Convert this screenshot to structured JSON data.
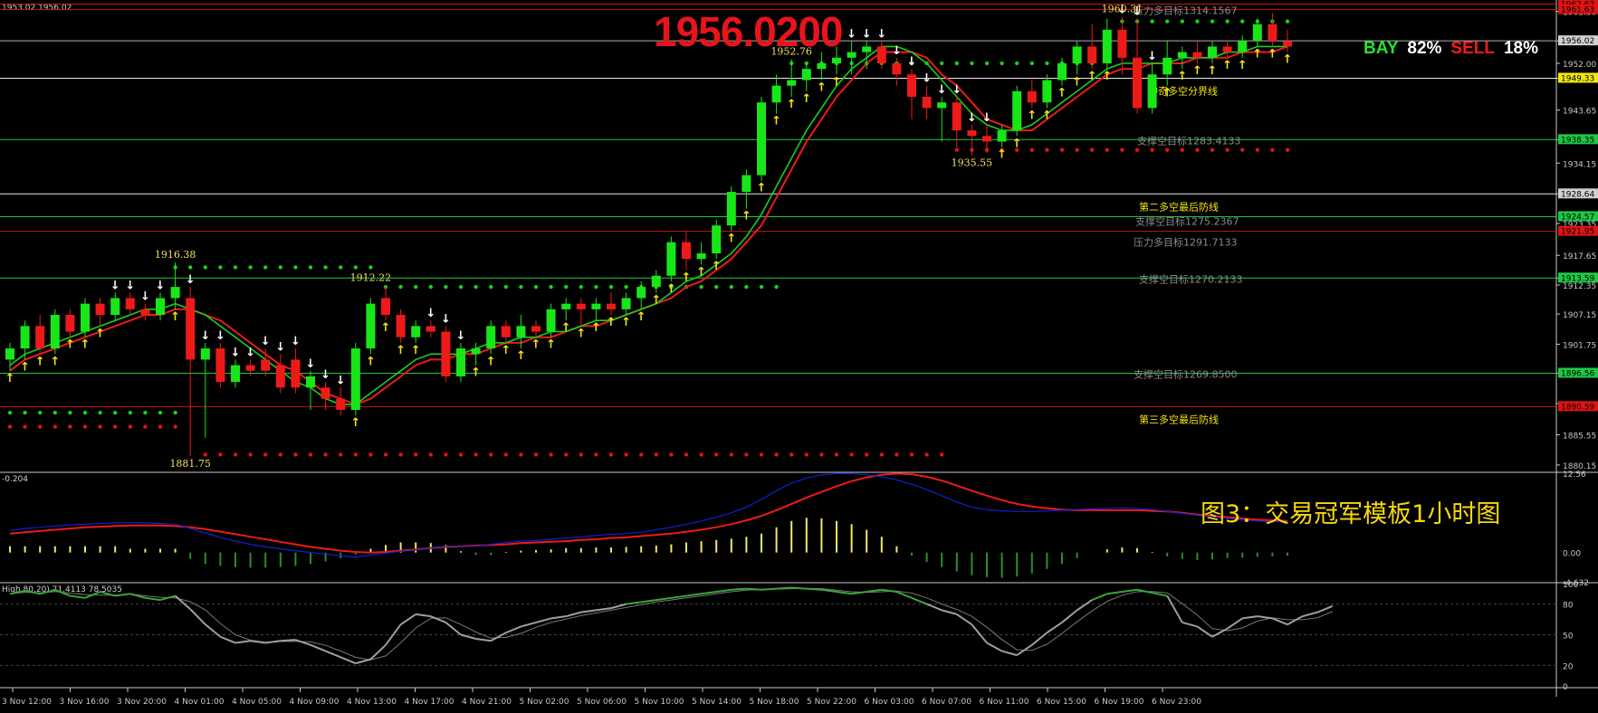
{
  "header": {
    "symbol_info": "1953.02 1956.02"
  },
  "big_price": "1956.0200",
  "sentiment": {
    "buy_label": "BAY",
    "buy_pct": "82%",
    "sell_label": "SELL",
    "sell_pct": "18%",
    "buy_color": "#27e12f",
    "sell_color": "#f51b1b"
  },
  "caption": "图3：交易冠军模板1小时图",
  "colors": {
    "bull": "#19e619",
    "bear": "#ee1a1a",
    "ma_fast": "#19d019",
    "ma_slow": "#ee1a1a",
    "macd_line": "#1020d0",
    "signal_line": "#ee1a1a",
    "stoch": "#9aa0a4",
    "stoch_hi": "#3aa63a"
  },
  "chart_data": {
    "type": "candlestick",
    "price_axis": {
      "range": [
        1879.0,
        1963.0
      ],
      "ticks": [
        "1961.30",
        "1956.02",
        "1952.00",
        "1949.33",
        "1943.65",
        "1938.35",
        "1934.15",
        "1928.64",
        "1923.35",
        "1917.65",
        "1913.59",
        "1912.35",
        "1907.15",
        "1901.75",
        "1896.56",
        "1891.15",
        "1885.55",
        "1880.15"
      ]
    },
    "price_tags": [
      {
        "value": 1962.6,
        "label": "1962.63",
        "color": "#e01414"
      },
      {
        "value": 1961.6,
        "label": "1961.63",
        "color": "#e01414"
      },
      {
        "value": 1956.02,
        "label": "1956.02",
        "color": "#d0d0d0"
      },
      {
        "value": 1949.33,
        "label": "1949.33",
        "color": "#f2e60c"
      },
      {
        "value": 1938.35,
        "label": "1938.35",
        "color": "#1ec845"
      },
      {
        "value": 1928.64,
        "label": "1928.64",
        "color": "#d0d0d0"
      },
      {
        "value": 1924.57,
        "label": "1924.57",
        "color": "#1ec845"
      },
      {
        "value": 1921.95,
        "label": "1921.95",
        "color": "#e01414"
      },
      {
        "value": 1913.59,
        "label": "1913.59",
        "color": "#1ec845"
      },
      {
        "value": 1896.56,
        "label": "1896.56",
        "color": "#1ec845"
      },
      {
        "value": 1890.59,
        "label": "1890.59",
        "color": "#e01414"
      }
    ],
    "levels": [
      {
        "value": 1962.6,
        "color": "#c81414",
        "text": ""
      },
      {
        "value": 1961.6,
        "color": "#c81414",
        "text": "压力多目标1314.1567"
      },
      {
        "value": 1956.02,
        "color": "#b0b0b0",
        "text": ""
      },
      {
        "value": 1949.33,
        "color": "#e8e8e8",
        "text": "神奇多空分界线"
      },
      {
        "value": 1938.35,
        "color": "#1ec845",
        "text": "支撑空目标1283.4133"
      },
      {
        "value": 1928.64,
        "color": "#e8e8e8",
        "text": "第二多空最后防线"
      },
      {
        "value": 1924.57,
        "color": "#1ec845",
        "text": "支撑空目标1275.2367"
      },
      {
        "value": 1921.95,
        "color": "#c81414",
        "text": "压力多目标1291.7133"
      },
      {
        "value": 1913.59,
        "color": "#1ec845",
        "text": "支撑空目标1270.2133"
      },
      {
        "value": 1896.56,
        "color": "#1ec845",
        "text": "支撑空目标1269.8500"
      },
      {
        "value": 1890.59,
        "color": "#c81414",
        "text": "第三多空最后防线"
      }
    ],
    "x_labels": [
      "3 Nov 12:00",
      "3 Nov 16:00",
      "3 Nov 20:00",
      "4 Nov 01:00",
      "4 Nov 05:00",
      "4 Nov 09:00",
      "4 Nov 13:00",
      "4 Nov 17:00",
      "4 Nov 21:00",
      "5 Nov 02:00",
      "5 Nov 06:00",
      "5 Nov 10:00",
      "5 Nov 14:00",
      "5 Nov 18:00",
      "5 Nov 22:00",
      "6 Nov 03:00",
      "6 Nov 07:00",
      "6 Nov 11:00",
      "6 Nov 15:00",
      "6 Nov 19:00",
      "6 Nov 23:00"
    ],
    "annotations": [
      {
        "label": "1916.38",
        "value": 1916.38,
        "bar": 11
      },
      {
        "label": "1881.75",
        "value": 1881.75,
        "bar": 12
      },
      {
        "label": "1912.22",
        "value": 1912.22,
        "bar": 24
      },
      {
        "label": "1952.76",
        "value": 1952.76,
        "bar": 52
      },
      {
        "label": "1935.55",
        "value": 1935.55,
        "bar": 64
      },
      {
        "label": "1960.31",
        "value": 1960.31,
        "bar": 74
      }
    ],
    "candles": [
      [
        1899,
        1902,
        1897,
        1901
      ],
      [
        1901,
        1906,
        1899,
        1905
      ],
      [
        1905,
        1907,
        1900,
        1901
      ],
      [
        1901,
        1908,
        1900,
        1907
      ],
      [
        1907,
        1908,
        1903,
        1904
      ],
      [
        1904,
        1910,
        1903,
        1909
      ],
      [
        1909,
        1910,
        1905,
        1907
      ],
      [
        1907,
        1911,
        1906,
        1910
      ],
      [
        1910,
        1911,
        1907,
        1908
      ],
      [
        1908,
        1909,
        1906,
        1907
      ],
      [
        1907,
        1911,
        1906,
        1910
      ],
      [
        1910,
        1916.38,
        1908,
        1912
      ],
      [
        1910,
        1912,
        1881.75,
        1899
      ],
      [
        1899,
        1902,
        1885,
        1901
      ],
      [
        1901,
        1902,
        1894,
        1895
      ],
      [
        1895,
        1899,
        1894,
        1898
      ],
      [
        1898,
        1899,
        1896,
        1897
      ],
      [
        1899,
        1901,
        1896,
        1897
      ],
      [
        1898,
        1900,
        1893,
        1894
      ],
      [
        1899,
        1901,
        1893,
        1894
      ],
      [
        1894,
        1897,
        1890,
        1896
      ],
      [
        1894,
        1895,
        1890,
        1892
      ],
      [
        1892,
        1894,
        1889,
        1890
      ],
      [
        1890,
        1902,
        1889,
        1901
      ],
      [
        1901,
        1910,
        1900,
        1909
      ],
      [
        1910,
        1912.22,
        1906,
        1907
      ],
      [
        1907,
        1908,
        1902,
        1903
      ],
      [
        1903,
        1906,
        1902,
        1905
      ],
      [
        1905,
        1906,
        1903,
        1904
      ],
      [
        1904,
        1905,
        1895,
        1896
      ],
      [
        1896,
        1902,
        1895,
        1901
      ],
      [
        1900,
        1902,
        1898,
        1901
      ],
      [
        1901,
        1906,
        1900,
        1905
      ],
      [
        1905,
        1906,
        1902,
        1903
      ],
      [
        1903,
        1907,
        1901,
        1905
      ],
      [
        1905,
        1906,
        1903,
        1904
      ],
      [
        1904,
        1909,
        1903,
        1908
      ],
      [
        1908,
        1910,
        1906,
        1909
      ],
      [
        1909,
        1910,
        1905,
        1908
      ],
      [
        1908,
        1910,
        1906,
        1909
      ],
      [
        1909,
        1911,
        1907,
        1908
      ],
      [
        1908,
        1911,
        1907,
        1910
      ],
      [
        1910,
        1913,
        1908,
        1912
      ],
      [
        1912,
        1915,
        1911,
        1914
      ],
      [
        1914,
        1921,
        1913,
        1920
      ],
      [
        1920,
        1922,
        1915,
        1917
      ],
      [
        1917,
        1920,
        1916,
        1918
      ],
      [
        1918,
        1924,
        1917,
        1923
      ],
      [
        1923,
        1930,
        1922,
        1929
      ],
      [
        1929,
        1933,
        1926,
        1932
      ],
      [
        1932,
        1946,
        1931,
        1945
      ],
      [
        1945,
        1950,
        1943,
        1948
      ],
      [
        1948,
        1952.76,
        1946,
        1949
      ],
      [
        1949,
        1952,
        1947,
        1951
      ],
      [
        1951,
        1954,
        1949,
        1952
      ],
      [
        1952,
        1955,
        1950,
        1953
      ],
      [
        1953,
        1956,
        1950,
        1954
      ],
      [
        1954,
        1956,
        1951,
        1955
      ],
      [
        1955,
        1956,
        1951,
        1952
      ],
      [
        1952,
        1953,
        1948,
        1950
      ],
      [
        1950,
        1951,
        1942,
        1946
      ],
      [
        1946,
        1948,
        1942,
        1944
      ],
      [
        1944,
        1946,
        1938,
        1945
      ],
      [
        1945,
        1946,
        1937,
        1940
      ],
      [
        1940,
        1941,
        1935.55,
        1939
      ],
      [
        1939,
        1941,
        1936,
        1938
      ],
      [
        1938,
        1941,
        1937,
        1940
      ],
      [
        1940,
        1948,
        1939,
        1947
      ],
      [
        1947,
        1949,
        1944,
        1945
      ],
      [
        1945,
        1950,
        1944,
        1949
      ],
      [
        1949,
        1953,
        1948,
        1952
      ],
      [
        1952,
        1956,
        1950,
        1955
      ],
      [
        1955,
        1959,
        1951,
        1952
      ],
      [
        1952,
        1960,
        1951,
        1958
      ],
      [
        1958,
        1960.31,
        1950,
        1953
      ],
      [
        1953,
        1960,
        1943,
        1944
      ],
      [
        1944,
        1952,
        1943,
        1950
      ],
      [
        1950,
        1956,
        1948,
        1953
      ],
      [
        1953,
        1955,
        1951,
        1954
      ],
      [
        1954,
        1956,
        1952,
        1953
      ],
      [
        1953,
        1956,
        1952,
        1955
      ],
      [
        1955,
        1956,
        1953,
        1954
      ],
      [
        1954,
        1957,
        1953,
        1956
      ],
      [
        1956,
        1960,
        1955,
        1959
      ],
      [
        1959,
        1961,
        1955,
        1956
      ],
      [
        1956,
        1958,
        1954,
        1955
      ]
    ],
    "buy_sell_arrows": [
      "buy",
      "buy",
      "buy",
      "buy",
      "buy",
      "buy",
      "buy",
      "sell",
      "sell",
      "sell",
      "sell",
      "buy",
      "sell",
      "sell",
      "sell",
      "sell",
      "sell",
      "sell",
      "sell",
      "sell",
      "sell",
      "sell",
      "sell",
      "buy",
      "buy",
      "buy",
      "buy",
      "buy",
      "sell",
      "sell",
      "sell",
      "buy",
      "buy",
      "buy",
      "buy",
      "buy",
      "buy",
      "buy",
      "buy",
      "buy",
      "buy",
      "buy",
      "buy",
      "buy",
      "buy",
      "buy",
      "buy",
      "buy",
      "buy",
      "buy",
      "buy",
      "buy",
      "buy",
      "buy",
      "buy",
      "buy",
      "sell",
      "sell",
      "sell",
      "sell",
      "sell",
      "sell",
      "sell",
      "sell",
      "sell",
      "sell",
      "buy",
      "buy",
      "buy",
      "buy",
      "buy",
      "buy",
      "buy",
      "buy",
      "sell",
      "sell",
      "sell",
      "buy",
      "buy",
      "buy",
      "buy",
      "buy",
      "buy",
      "buy",
      "buy",
      "buy"
    ],
    "ma_fast": [
      1898,
      1900,
      1901,
      1902,
      1903,
      1904,
      1905,
      1906,
      1907,
      1908,
      1908,
      1909,
      1908,
      1907,
      1905,
      1903,
      1901,
      1899,
      1897,
      1895,
      1894,
      1892,
      1891,
      1891,
      1893,
      1895,
      1897,
      1899,
      1900,
      1900,
      1900,
      1901,
      1902,
      1902,
      1903,
      1903,
      1904,
      1904,
      1905,
      1906,
      1906,
      1907,
      1908,
      1909,
      1911,
      1913,
      1914,
      1916,
      1918,
      1921,
      1925,
      1930,
      1935,
      1940,
      1944,
      1948,
      1951,
      1953,
      1955,
      1955,
      1954,
      1952,
      1949,
      1946,
      1943,
      1941,
      1940,
      1940,
      1941,
      1943,
      1945,
      1947,
      1949,
      1951,
      1952,
      1952,
      1952,
      1952,
      1953,
      1953,
      1953,
      1954,
      1954,
      1955,
      1955,
      1955
    ],
    "ma_slow": [
      1897,
      1899,
      1900,
      1901,
      1902,
      1903,
      1904,
      1905,
      1906,
      1907,
      1907,
      1908,
      1908,
      1907,
      1906,
      1904,
      1902,
      1900,
      1898,
      1897,
      1895,
      1893,
      1892,
      1891,
      1892,
      1894,
      1896,
      1898,
      1899,
      1899,
      1900,
      1900,
      1901,
      1902,
      1902,
      1903,
      1903,
      1904,
      1905,
      1905,
      1906,
      1907,
      1908,
      1909,
      1910,
      1912,
      1913,
      1915,
      1917,
      1920,
      1923,
      1928,
      1933,
      1938,
      1942,
      1946,
      1949,
      1952,
      1954,
      1954,
      1954,
      1953,
      1950,
      1948,
      1945,
      1942,
      1941,
      1940,
      1940,
      1942,
      1944,
      1946,
      1948,
      1950,
      1951,
      1951,
      1952,
      1952,
      1952,
      1953,
      1953,
      1953,
      1954,
      1954,
      1954,
      1955
    ],
    "dots": [
      {
        "color": "#19d019",
        "value": 1959.5,
        "from": 74,
        "to": 85
      },
      {
        "color": "#19d019",
        "value": 1952.0,
        "from": 52,
        "to": 72
      },
      {
        "color": "#e01414",
        "value": 1936.5,
        "from": 63,
        "to": 85
      },
      {
        "color": "#19d019",
        "value": 1915.5,
        "from": 11,
        "to": 24
      },
      {
        "color": "#19d019",
        "value": 1912.0,
        "from": 25,
        "to": 51
      },
      {
        "color": "#19d019",
        "value": 1889.5,
        "from": 0,
        "to": 11
      },
      {
        "color": "#e01414",
        "value": 1887.0,
        "from": 0,
        "to": 11
      },
      {
        "color": "#e01414",
        "value": 1882.0,
        "from": 13,
        "to": 62
      }
    ],
    "macd": {
      "header": "-0.204",
      "ticks": [
        "12.56",
        "0.00",
        "-4.632"
      ],
      "range": [
        -4.632,
        12.56
      ],
      "histogram": [
        1,
        1,
        1,
        1,
        1,
        1,
        1,
        1,
        0.6,
        0.6,
        0.6,
        0.6,
        -1.0,
        -1.8,
        -2.1,
        -2.3,
        -2.4,
        -2.4,
        -2.3,
        -2.1,
        -1.8,
        -1.4,
        -0.9,
        -0.3,
        0.6,
        1.2,
        1.6,
        1.6,
        1.5,
        1.2,
        0.2,
        -0.4,
        -0.4,
        0.1,
        0.3,
        0.4,
        0.5,
        0.7,
        0.7,
        0.8,
        0.8,
        0.9,
        1.0,
        1.1,
        1.3,
        1.6,
        1.8,
        2.0,
        2.2,
        2.5,
        3.0,
        4.0,
        5.0,
        5.5,
        5.4,
        5.0,
        4.5,
        3.6,
        2.5,
        1.0,
        -0.5,
        -1.5,
        -2.3,
        -3.0,
        -3.6,
        -3.9,
        -4.0,
        -3.8,
        -3.3,
        -2.6,
        -1.8,
        -0.9,
        0.0,
        0.5,
        0.8,
        0.7,
        0.1,
        -0.6,
        -1.0,
        -1.2,
        -1.1,
        -0.9,
        -0.8,
        -0.7,
        -0.6,
        -0.5
      ],
      "line": [
        3.5,
        3.8,
        4.0,
        4.2,
        4.4,
        4.5,
        4.6,
        4.7,
        4.7,
        4.7,
        4.6,
        4.5,
        3.8,
        3.1,
        2.4,
        1.8,
        1.3,
        0.9,
        0.6,
        0.3,
        0.0,
        -0.2,
        -0.5,
        -0.7,
        -0.4,
        -0.1,
        0.2,
        0.4,
        0.7,
        1.0,
        1.0,
        1.0,
        1.3,
        1.6,
        1.8,
        1.9,
        2.1,
        2.3,
        2.5,
        2.7,
        2.9,
        3.0,
        3.2,
        3.6,
        4.0,
        4.5,
        5.0,
        5.6,
        6.3,
        7.2,
        8.4,
        9.8,
        11.0,
        11.8,
        12.3,
        12.5,
        12.5,
        12.3,
        12.0,
        11.5,
        10.8,
        10.0,
        9.0,
        8.0,
        7.2,
        6.8,
        6.6,
        6.5,
        6.5,
        6.6,
        6.7,
        6.8,
        6.9,
        7.0,
        7.1,
        7.0,
        6.8,
        6.5,
        6.2,
        5.9,
        5.6,
        5.4,
        5.2,
        5.0,
        4.9,
        4.9
      ],
      "signal": [
        3.0,
        3.2,
        3.4,
        3.6,
        3.8,
        4.0,
        4.1,
        4.2,
        4.3,
        4.3,
        4.3,
        4.2,
        4.0,
        3.7,
        3.3,
        2.9,
        2.5,
        2.1,
        1.7,
        1.3,
        0.9,
        0.6,
        0.3,
        0.1,
        0.0,
        0.1,
        0.3,
        0.5,
        0.7,
        0.9,
        1.0,
        1.1,
        1.2,
        1.3,
        1.5,
        1.6,
        1.7,
        1.8,
        2.0,
        2.1,
        2.3,
        2.4,
        2.6,
        2.8,
        3.0,
        3.3,
        3.6,
        4.0,
        4.5,
        5.1,
        5.8,
        6.7,
        7.7,
        8.7,
        9.6,
        10.5,
        11.3,
        11.9,
        12.3,
        12.5,
        12.4,
        12.0,
        11.4,
        10.6,
        9.8,
        9.0,
        8.3,
        7.7,
        7.3,
        7.0,
        6.8,
        6.7,
        6.7,
        6.7,
        6.7,
        6.7,
        6.6,
        6.5,
        6.3,
        6.0,
        5.8,
        5.6,
        5.4,
        5.2,
        5.1,
        5.0
      ]
    },
    "stochastic": {
      "header": "High,80,20) 71.4113 78.5035",
      "ticks": [
        "100",
        "80",
        "50",
        "20",
        "0"
      ],
      "range": [
        0,
        100
      ],
      "main": [
        90,
        93,
        90,
        94,
        88,
        86,
        92,
        88,
        90,
        86,
        84,
        88,
        75,
        60,
        48,
        42,
        44,
        42,
        44,
        45,
        40,
        34,
        28,
        22,
        26,
        40,
        60,
        70,
        68,
        62,
        50,
        46,
        44,
        52,
        58,
        62,
        66,
        68,
        72,
        74,
        76,
        80,
        82,
        84,
        86,
        88,
        90,
        92,
        94,
        95,
        94,
        95,
        96,
        95,
        94,
        92,
        90,
        92,
        94,
        92,
        86,
        80,
        74,
        70,
        60,
        42,
        34,
        30,
        40,
        52,
        62,
        74,
        84,
        90,
        92,
        94,
        91,
        88,
        62,
        58,
        48,
        56,
        66,
        68,
        66,
        60,
        68,
        72,
        78
      ]
    }
  }
}
